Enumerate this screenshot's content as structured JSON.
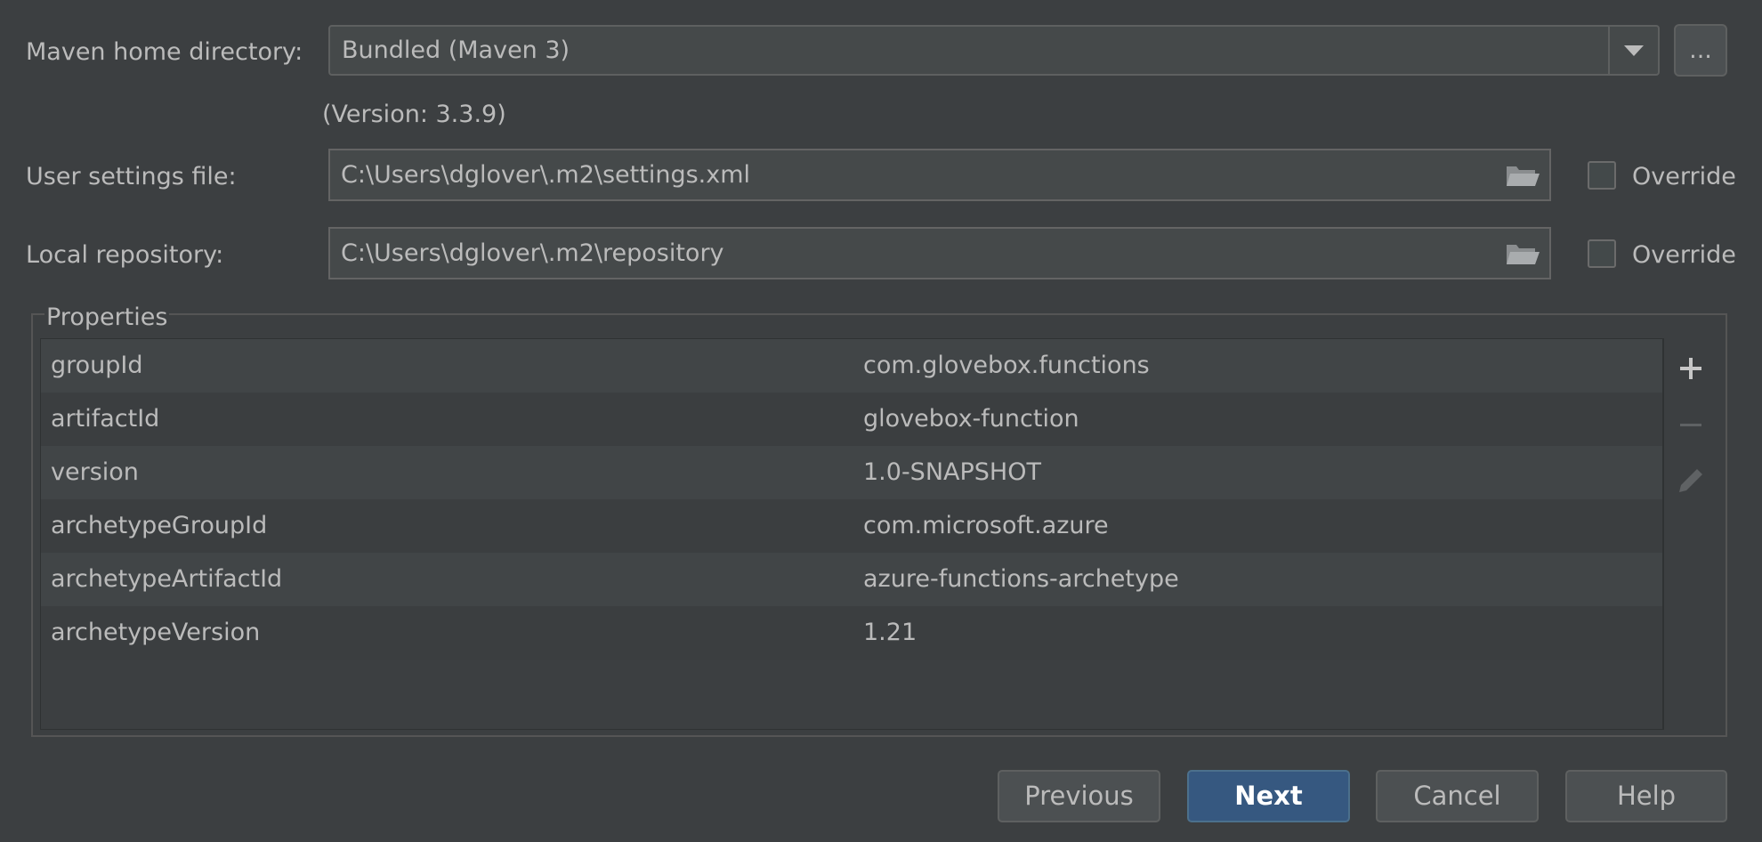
{
  "maven_home": {
    "label": "Maven home directory:",
    "selected": "Bundled (Maven 3)",
    "browse_label": "...",
    "version": "(Version: 3.3.9)"
  },
  "user_settings": {
    "label": "User settings file:",
    "value": "C:\\Users\\dglover\\.m2\\settings.xml",
    "override_label": "Override",
    "override_checked": false
  },
  "local_repo": {
    "label": "Local repository:",
    "value": "C:\\Users\\dglover\\.m2\\repository",
    "override_label": "Override",
    "override_checked": false
  },
  "properties": {
    "title": "Properties",
    "rows": [
      {
        "key": "groupId",
        "value": "com.glovebox.functions"
      },
      {
        "key": "artifactId",
        "value": "glovebox-function"
      },
      {
        "key": "version",
        "value": "1.0-SNAPSHOT"
      },
      {
        "key": "archetypeGroupId",
        "value": "com.microsoft.azure"
      },
      {
        "key": "archetypeArtifactId",
        "value": "azure-functions-archetype"
      },
      {
        "key": "archetypeVersion",
        "value": "1.21"
      }
    ],
    "toolbar_icons": [
      "plus-icon",
      "minus-icon",
      "pencil-icon"
    ]
  },
  "buttons": {
    "previous": "Previous",
    "next": "Next",
    "cancel": "Cancel",
    "help": "Help"
  },
  "colors": {
    "background": "#3c3f41",
    "primary_button": "#365880",
    "text": "#bbbbbb"
  }
}
